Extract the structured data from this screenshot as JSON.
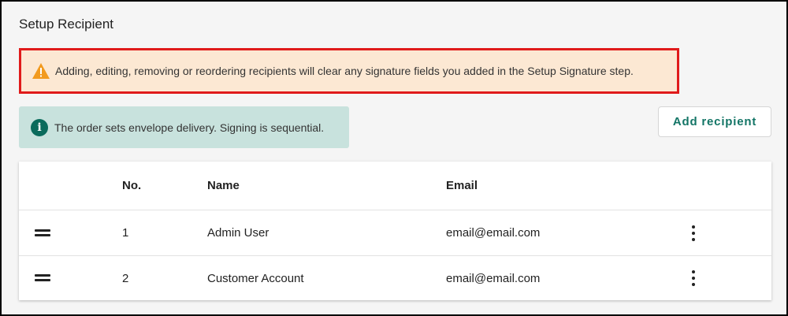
{
  "page": {
    "title": "Setup Recipient"
  },
  "warning": {
    "icon": "warning-icon",
    "text": "Adding, editing, removing or reordering recipients will clear any signature fields you added in the Setup Signature step.",
    "color_background": "#fce8d3",
    "color_border": "#e01b1b",
    "color_icon": "#f29a1f"
  },
  "info": {
    "icon": "info-icon",
    "text": "The order sets envelope delivery. Signing is sequential.",
    "color_background": "#c8e2dd",
    "color_icon": "#0b6b5c"
  },
  "actions": {
    "add_recipient_label": "Add recipient",
    "accent_color": "#137566"
  },
  "table": {
    "columns": {
      "no": "No.",
      "name": "Name",
      "email": "Email"
    },
    "rows": [
      {
        "no": "1",
        "name": "Admin User",
        "email": "email@email.com"
      },
      {
        "no": "2",
        "name": "Customer Account",
        "email": "email@email.com"
      }
    ]
  }
}
